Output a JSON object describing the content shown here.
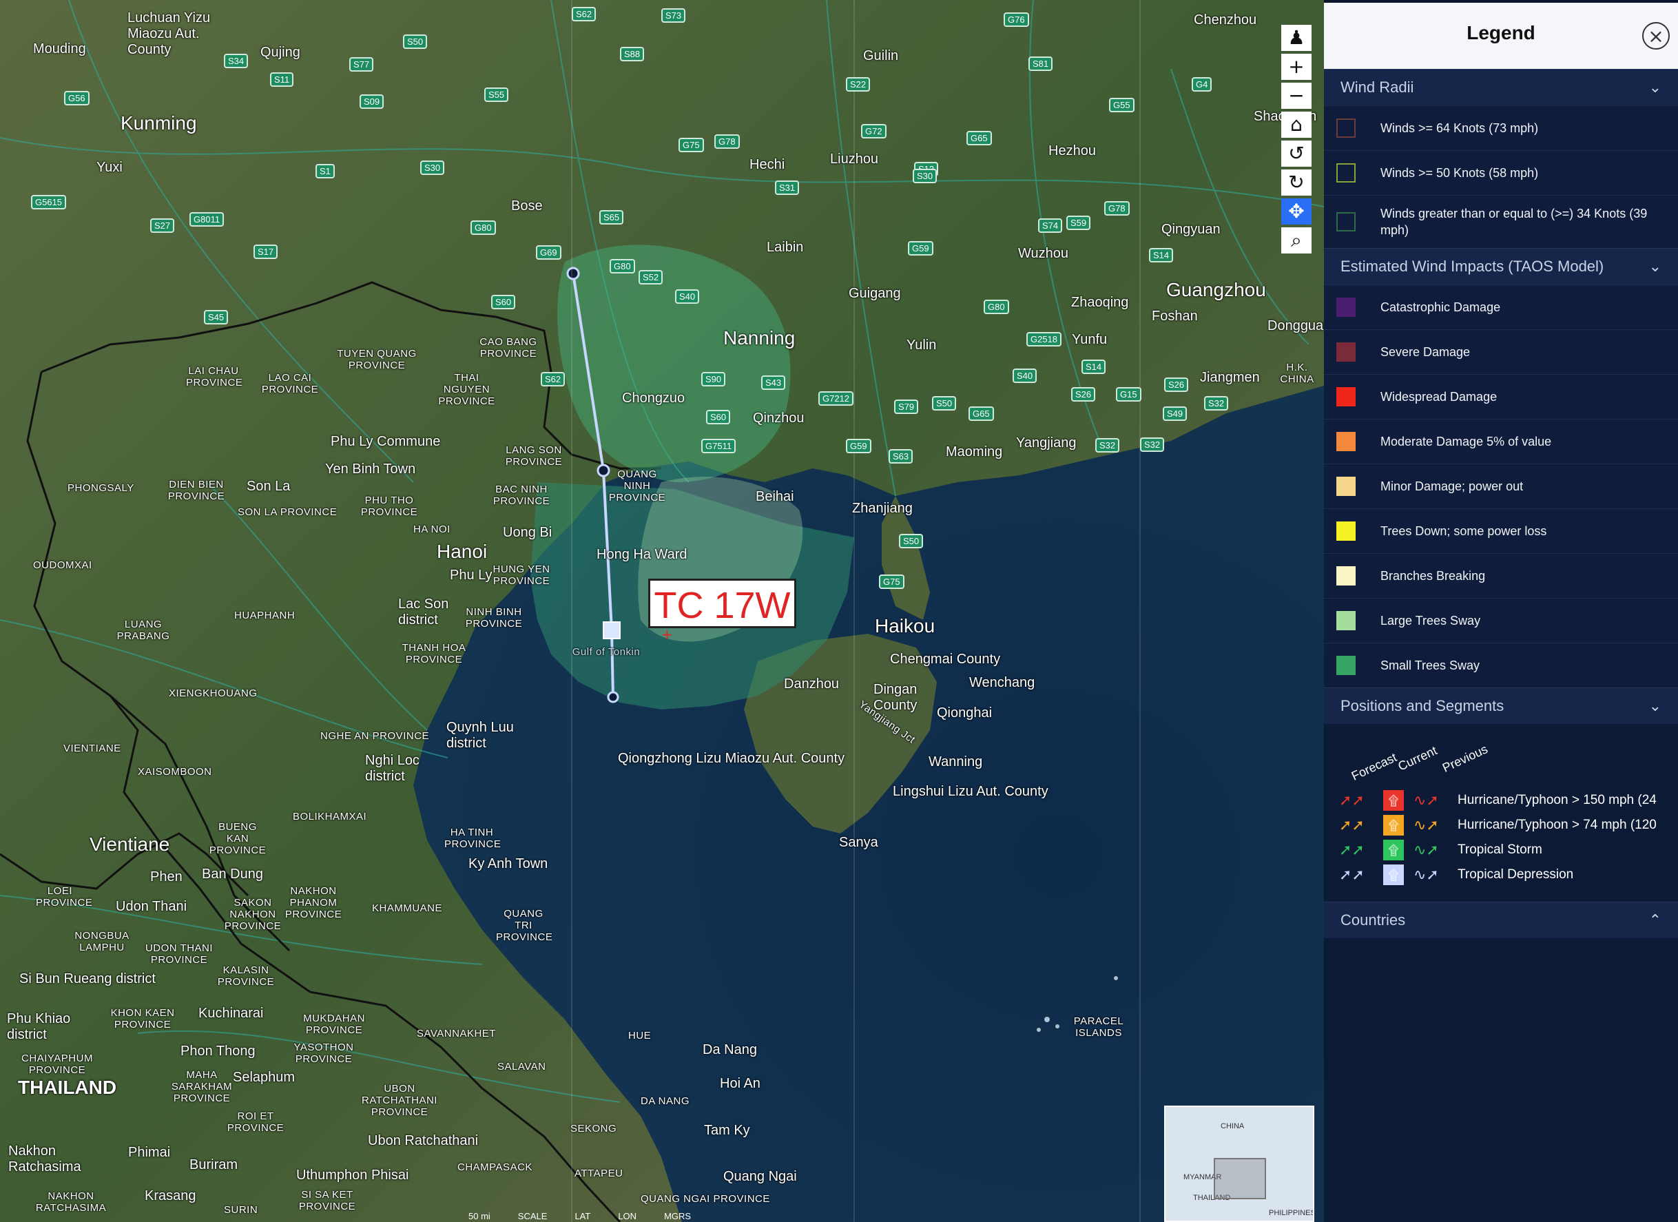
{
  "map": {
    "storm_label": "TC 17W",
    "places_large": [
      "Kunming",
      "Nanning",
      "Guangzhou",
      "Hanoi",
      "Haikou",
      "Vientiane",
      "THAILAND"
    ],
    "places_medium": [
      "Chenzhou",
      "Mouding",
      "Luchuan Yizu Miaozu Aut. County",
      "Qujing",
      "Guilin",
      "Hechi",
      "Liuzhou",
      "Hezhou",
      "Bose",
      "Laibin",
      "Wuzhou",
      "Qingyuan",
      "Guigang",
      "Yulin",
      "Zhaoqing",
      "Foshan",
      "Yunfu",
      "Jiangmen",
      "Chongzuo",
      "Qinzhou",
      "Beihai",
      "Zhanjiang",
      "Maoming",
      "Yangjiang",
      "Phu Ly Commune",
      "Yen Binh Town",
      "Son La",
      "Uong Bi",
      "Hong Ha Ward",
      "Phu Ly",
      "Lac Son district",
      "Quynh Luu district",
      "Nghi Loc district",
      "Chengmai County",
      "Wenchang",
      "Danzhou",
      "Dingan County",
      "Qionghai",
      "Wanning",
      "Qiongzhong Lizu Miaozu Aut. County",
      "Lingshui Lizu Aut. County",
      "Sanya",
      "Ky Anh Town",
      "Phen",
      "Ban Dung",
      "Udon Thani",
      "Si Bun Rueang district",
      "Phu Khiao district",
      "Kuchinarai",
      "Phon Thong",
      "Selaphum",
      "Ubon Ratchathani",
      "Nakhon Ratchasima",
      "Phimai",
      "Buriram",
      "Uthumphon Phisai",
      "Krasang",
      "Da Nang",
      "Hoi An",
      "Tam Ky",
      "Quang Ngai",
      "Yuxi",
      "Shaoguan",
      "Dongguan"
    ],
    "places_small": [
      "TUYEN QUANG PROVINCE",
      "LAI CHAU PROVINCE",
      "LAO CAI PROVINCE",
      "CAO BANG PROVINCE",
      "THAI NGUYEN PROVINCE",
      "LANG SON PROVINCE",
      "QUANG NINH PROVINCE",
      "BAC NINH PROVINCE",
      "PHONGSALY",
      "DIEN BIEN PROVINCE",
      "SON LA PROVINCE",
      "PHU THO PROVINCE",
      "HA NOI",
      "HUNG YEN PROVINCE",
      "NINH BINH PROVINCE",
      "OUDOMXAI",
      "LUANG PRABANG",
      "HUAPHANH",
      "THANH HOA PROVINCE",
      "XIENGKHOUANG",
      "NGHE AN PROVINCE",
      "VIENTIANE",
      "XAISOMBOON",
      "BOLIKHAMXAI",
      "HA TINH PROVINCE",
      "BUENG KAN PROVINCE",
      "LOEI PROVINCE",
      "NAKHON PHANOM PROVINCE",
      "SAKON NAKHON PROVINCE",
      "KHAMMUANE",
      "QUANG TRI PROVINCE",
      "NONGBUA LAMPHU",
      "UDON THANI PROVINCE",
      "KALASIN PROVINCE",
      "KHON KAEN PROVINCE",
      "MUKDAHAN PROVINCE",
      "SAVANNAKHET",
      "CHAIYAPHUM PROVINCE",
      "YASOTHON PROVINCE",
      "MAHA SARAKHAM PROVINCE",
      "ROI ET PROVINCE",
      "UBON RATCHATHANI PROVINCE",
      "SALAVAN",
      "SEKONG",
      "CHAMPASACK",
      "ATTAPEU",
      "SURIN",
      "SI SA KET PROVINCE",
      "NAKHON RATCHASIMA",
      "HUE",
      "DA NANG",
      "QUANG NGAI PROVINCE",
      "PARACEL ISLANDS",
      "H.K. CHINA",
      "Gulf of Tonkin",
      "Yangjiang Jct"
    ],
    "shields": [
      "S62",
      "S73",
      "G76",
      "S50",
      "S88",
      "S34",
      "S11",
      "S77",
      "S09",
      "S55",
      "G56",
      "S22",
      "S81",
      "G4",
      "G55",
      "G72",
      "G75",
      "G78",
      "S30",
      "G65",
      "S13",
      "S1",
      "S31",
      "S30",
      "G5615",
      "G8011",
      "S27",
      "G80",
      "S65",
      "G78",
      "S74",
      "S59",
      "S17",
      "G69",
      "G80",
      "S52",
      "G59",
      "S14",
      "S40",
      "S45",
      "S60",
      "G80",
      "G2518",
      "S40",
      "S14",
      "S26",
      "S26",
      "G15",
      "S49",
      "S32",
      "S62",
      "S90",
      "S43",
      "G7212",
      "S79",
      "S50",
      "G65",
      "S60",
      "G7511",
      "G59",
      "S63",
      "S32",
      "S32",
      "S50",
      "G75"
    ],
    "toolbar": [
      "person-icon",
      "zoom-in-icon",
      "zoom-out-icon",
      "home-icon",
      "rotate-left-icon",
      "rotate-right-icon",
      "pan-icon",
      "zoom-box-icon"
    ],
    "minimap": {
      "label1": "CHINA",
      "label2": "MYANMAR",
      "label3": "THAILAND",
      "label4": "PHILIPPINES"
    },
    "scale_text": [
      "50 mi",
      "SCALE",
      "LAT",
      "LON",
      "MGRS"
    ]
  },
  "legend": {
    "title": "Legend",
    "close_icon": "close-circle-icon",
    "wind_radii": {
      "title": "Wind Radii",
      "items": [
        {
          "label": "Winds >= 64 Knots (73 mph)",
          "color": "#6a3b3b"
        },
        {
          "label": "Winds >= 50 Knots (58 mph)",
          "color": "#8aa23a"
        },
        {
          "label": "Winds greater than or equal to (>=) 34 Knots (39 mph)",
          "color": "#2f6b4b"
        }
      ]
    },
    "taos": {
      "title": "Estimated Wind Impacts (TAOS Model)",
      "items": [
        {
          "label": "Catastrophic Damage",
          "color": "#4a1d6e"
        },
        {
          "label": "Severe Damage",
          "color": "#7a2a38"
        },
        {
          "label": "Widespread Damage",
          "color": "#f0261a"
        },
        {
          "label": "Moderate Damage 5% of value",
          "color": "#f5883c"
        },
        {
          "label": "Minor Damage; power out",
          "color": "#f5d68a"
        },
        {
          "label": "Trees Down; some power loss",
          "color": "#f7f224"
        },
        {
          "label": "Branches Breaking",
          "color": "#fbf5c6"
        },
        {
          "label": "Large Trees Sway",
          "color": "#a4dd9c"
        },
        {
          "label": "Small Trees Sway",
          "color": "#36a564"
        }
      ]
    },
    "positions": {
      "title": "Positions and Segments",
      "headers": [
        "Forecast",
        "Current",
        "Previous"
      ],
      "items": [
        {
          "label": "Hurricane/Typhoon > 150 mph (24",
          "color": "#e8342a"
        },
        {
          "label": "Hurricane/Typhoon > 74 mph (120",
          "color": "#f5a623"
        },
        {
          "label": "Tropical Storm",
          "color": "#2dc55e"
        },
        {
          "label": "Tropical Depression",
          "color": "#c9d6ff"
        }
      ]
    },
    "countries": {
      "title": "Countries"
    }
  }
}
